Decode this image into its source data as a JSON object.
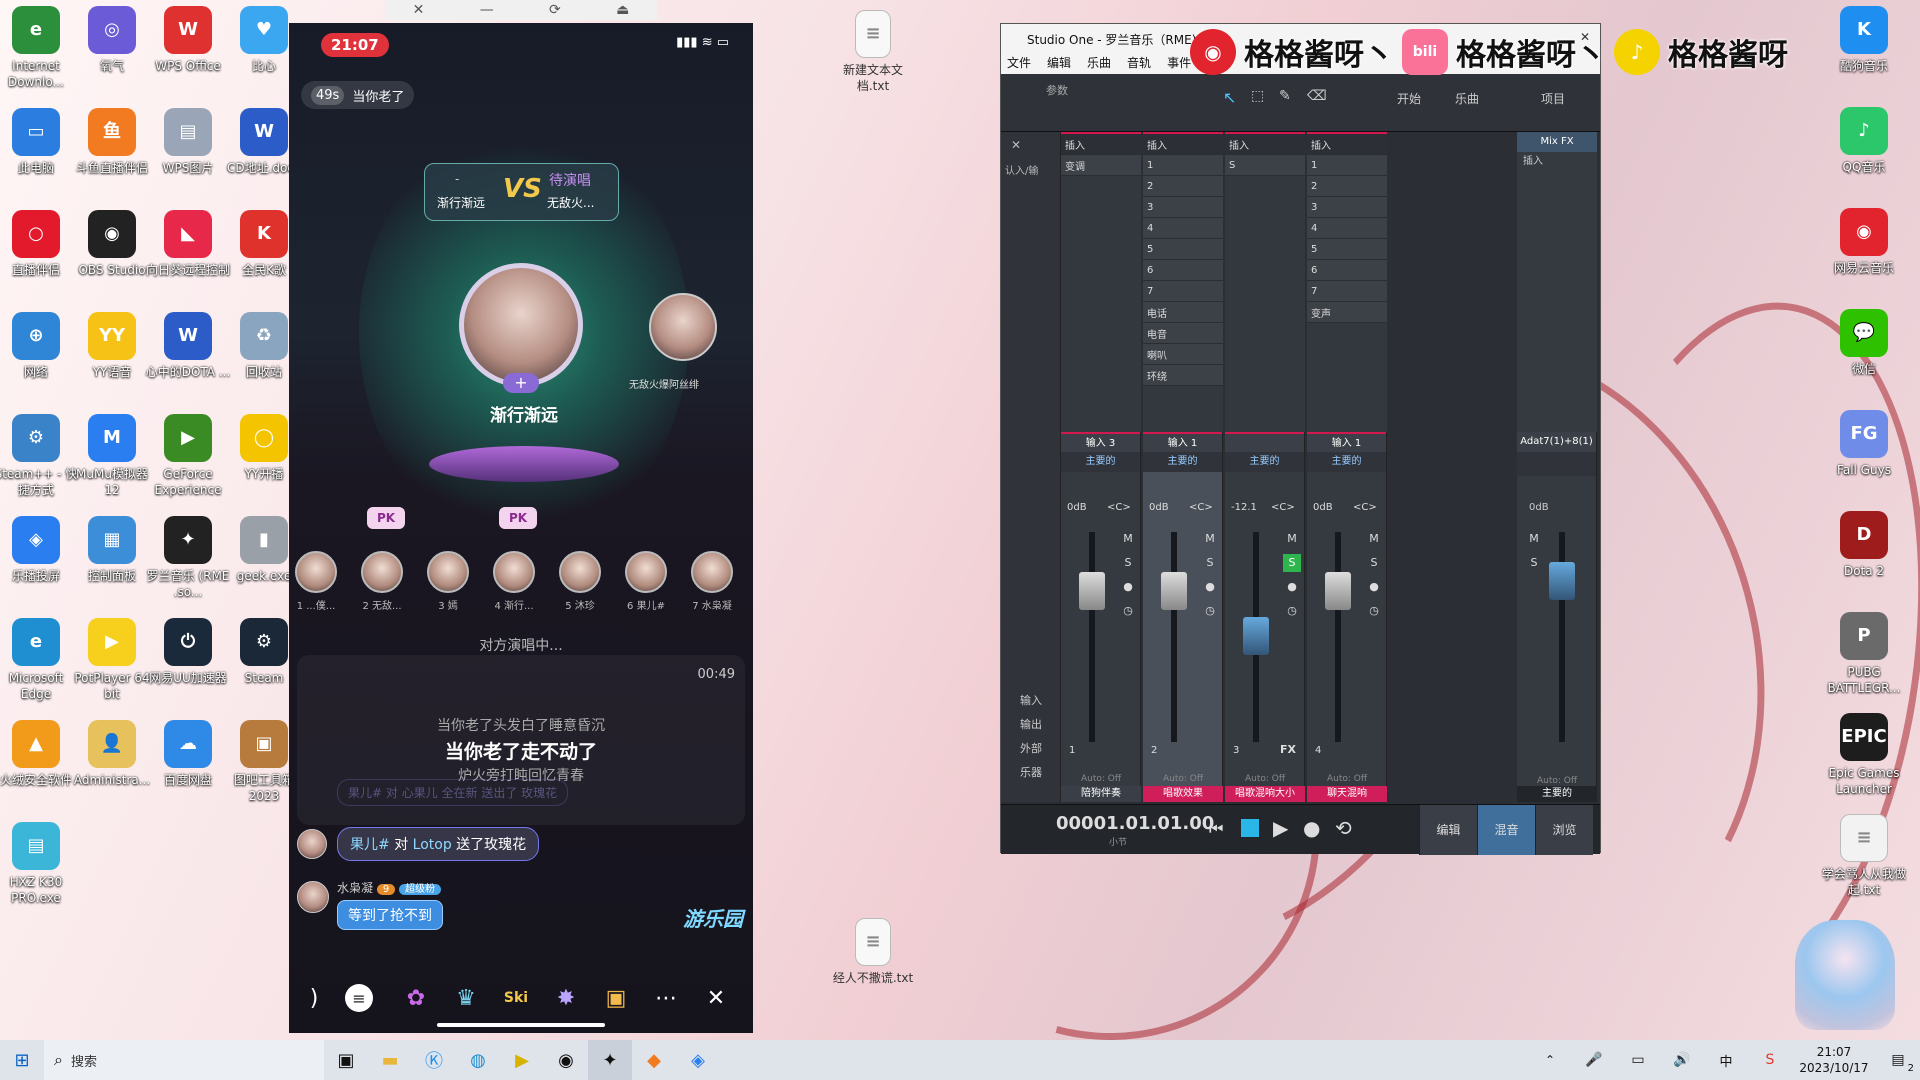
{
  "desktop": {
    "left_icons": [
      {
        "label": "Internet Downlo...",
        "icon": "idm-icon",
        "color": "#2c8f3b",
        "glyph": "e"
      },
      {
        "label": "氧气",
        "icon": "oxygen-icon",
        "color": "#6b5bd6",
        "glyph": "◎"
      },
      {
        "label": "WPS Office",
        "icon": "wps-office-icon",
        "color": "#e03131",
        "glyph": "W"
      },
      {
        "label": "比心",
        "icon": "bixin-icon",
        "color": "#3aa7f0",
        "glyph": "♥"
      },
      {
        "label": "此电脑",
        "icon": "this-pc-icon",
        "color": "#2b7de0",
        "glyph": "▭"
      },
      {
        "label": "斗鱼直播伴侣",
        "icon": "douyu-icon",
        "color": "#f27a21",
        "glyph": "鱼"
      },
      {
        "label": "WPS图片",
        "icon": "wps-image-icon",
        "color": "#9aa5b8",
        "glyph": "▤"
      },
      {
        "label": "CD地址.docx",
        "icon": "word-doc-icon",
        "color": "#2b5cc8",
        "glyph": "W"
      },
      {
        "label": "直播伴侣",
        "icon": "live-companion-icon",
        "color": "#e3192c",
        "glyph": "○"
      },
      {
        "label": "OBS Studio",
        "icon": "obs-icon",
        "color": "#222",
        "glyph": "◉"
      },
      {
        "label": "向日葵远程控制",
        "icon": "sunflower-icon",
        "color": "#e8284a",
        "glyph": "◣"
      },
      {
        "label": "全民K歌",
        "icon": "quanmin-k-icon",
        "color": "#e0322d",
        "glyph": "K"
      },
      {
        "label": "网络",
        "icon": "network-icon",
        "color": "#2f86d6",
        "glyph": "⊕"
      },
      {
        "label": "YY语音",
        "icon": "yy-icon",
        "color": "#f6c216",
        "glyph": "YY"
      },
      {
        "label": "心中的DOTA ...",
        "icon": "word-doc-icon",
        "color": "#2b5cc8",
        "glyph": "W"
      },
      {
        "label": "回收站",
        "icon": "recycle-bin-icon",
        "color": "#8aa5c0",
        "glyph": "♻"
      },
      {
        "label": "Steam++ - 快捷方式",
        "icon": "steampp-icon",
        "color": "#3b83c9",
        "glyph": "⚙"
      },
      {
        "label": "MuMu模拟器12",
        "icon": "mumu-icon",
        "color": "#2a7ef0",
        "glyph": "M"
      },
      {
        "label": "GeForce Experience",
        "icon": "geforce-icon",
        "color": "#3b8b25",
        "glyph": "▶"
      },
      {
        "label": "YY开播",
        "icon": "yy-live-icon",
        "color": "#f5c400",
        "glyph": "◯"
      },
      {
        "label": "乐播投屏",
        "icon": "lebo-icon",
        "color": "#2a7ef0",
        "glyph": "◈"
      },
      {
        "label": "控制面板",
        "icon": "control-panel-icon",
        "color": "#3c8ed8",
        "glyph": "▦"
      },
      {
        "label": "罗兰音乐 (RME .so...",
        "icon": "studio-one-icon",
        "color": "#222",
        "glyph": "✦"
      },
      {
        "label": "geek.exe",
        "icon": "geek-icon",
        "color": "#9aa0a8",
        "glyph": "▮"
      },
      {
        "label": "Microsoft Edge",
        "icon": "edge-icon",
        "color": "#1f8fd1",
        "glyph": "e"
      },
      {
        "label": "PotPlayer 64 bit",
        "icon": "potplayer-icon",
        "color": "#f7cf1d",
        "glyph": "▶"
      },
      {
        "label": "网易UU加速器",
        "icon": "uu-icon",
        "color": "#1b2a3a",
        "glyph": "⏻"
      },
      {
        "label": "Steam",
        "icon": "steam-icon",
        "color": "#1b2838",
        "glyph": "⚙"
      },
      {
        "label": "火绒安全软件",
        "icon": "huorong-icon",
        "color": "#f29a1a",
        "glyph": "▲"
      },
      {
        "label": "Administra...",
        "icon": "user-folder-icon",
        "color": "#e7c25c",
        "glyph": "👤"
      },
      {
        "label": "百度网盘",
        "icon": "baidu-netdisk-icon",
        "color": "#2e8ae6",
        "glyph": "☁"
      },
      {
        "label": "图吧工具箱2023",
        "icon": "tuba-icon",
        "color": "#b67b3d",
        "glyph": "▣"
      },
      {
        "label": "HXZ K30 PRO.exe",
        "icon": "exe-icon",
        "color": "#3bb5d8",
        "glyph": "▤"
      }
    ],
    "middle_icons": [
      {
        "label": "新建文本文档.txt",
        "icon": "text-file-icon"
      },
      {
        "label": "经人不撒谎.txt",
        "icon": "text-file-icon"
      }
    ],
    "right_icons": [
      {
        "label": "酷狗音乐",
        "icon": "kugou-icon",
        "color": "#1e8ff0",
        "glyph": "K"
      },
      {
        "label": "QQ音乐",
        "icon": "qq-music-icon",
        "color": "#2cc66b",
        "glyph": "♪"
      },
      {
        "label": "网易云音乐",
        "icon": "netease-music-icon",
        "color": "#e1242e",
        "glyph": "◉"
      },
      {
        "label": "微信",
        "icon": "wechat-icon",
        "color": "#2dc100",
        "glyph": "💬"
      },
      {
        "label": "Fall Guys",
        "icon": "fall-guys-icon",
        "color": "#6f8de8",
        "glyph": "FG"
      },
      {
        "label": "Dota 2",
        "icon": "dota2-icon",
        "color": "#9e1c1c",
        "glyph": "D"
      },
      {
        "label": "PUBG BATTLEGR...",
        "icon": "pubg-icon",
        "color": "#6a6a6a",
        "glyph": "P"
      },
      {
        "label": "Epic Games Launcher",
        "icon": "epic-icon",
        "color": "#1d1d1d",
        "glyph": "EPIC"
      },
      {
        "label": "学会骂人从我做起.txt",
        "icon": "text-file-icon",
        "color": "#f2f2f2",
        "glyph": "≡"
      }
    ]
  },
  "phone": {
    "time": "21:07",
    "topic_pill": {
      "prefix": "49s",
      "text": "当你老了"
    },
    "pk": {
      "vs": "VS",
      "left_dash": "-",
      "left_name": "渐行渐远",
      "right_status": "待演唱",
      "right_name": "无敌火..."
    },
    "singer_name": "渐行渐远",
    "side_name": "无敌火爆阿丝绯",
    "seats": [
      "1 ...僕...",
      "2 无敌...",
      "3 嫣",
      "4 渐行...",
      "5 沐珍",
      "6 果儿#",
      "7 水枭凝"
    ],
    "pk_badge": "PK",
    "status": "对方演唱中...",
    "lyric_time": "00:49",
    "lyrics": [
      "当你老了头发白了睡意昏沉",
      "当你老了走不动了",
      "炉火旁打盹回忆青春"
    ],
    "chat": {
      "gift_user": "果儿#",
      "gift_text": "对",
      "gift_target": "Lotop",
      "gift_suffix": "送了玫瑰花",
      "faded_gift": "果儿# 对 心果儿 全在新 送出了 玫瑰花",
      "msg_user": "水枭凝",
      "msg_level": "9",
      "msg_badge": "超级粉",
      "msg_text": "等到了抢不到"
    },
    "park_label": "游乐园"
  },
  "studio": {
    "title": "Studio One - 罗兰音乐（RME)",
    "menu": [
      "文件",
      "编辑",
      "乐曲",
      "音轨",
      "事件"
    ],
    "toolbar": {
      "params": "参数",
      "start": "开始",
      "song": "乐曲",
      "project": "项目"
    },
    "insert_label": "插入",
    "input_label": "认入/输",
    "mixfx": "Mix FX",
    "strip_slots": [
      [
        "变调"
      ],
      [
        "1",
        "2",
        "3",
        "4",
        "5",
        "6",
        "7",
        "电话",
        "电音",
        "喇叭",
        "环绕"
      ],
      [
        "S"
      ],
      [
        "1",
        "2",
        "3",
        "4",
        "5",
        "6",
        "7",
        "变声"
      ]
    ],
    "channels": [
      {
        "input": "输入 3",
        "bus": "主要的",
        "vol": "0dB",
        "pan": "<C>",
        "num": "1",
        "label": "陪狗伴奏",
        "label_color": "#3a3f47"
      },
      {
        "input": "输入 1",
        "bus": "主要的",
        "vol": "0dB",
        "pan": "<C>",
        "num": "2",
        "label": "唱歌效果",
        "label_color": "#d01e5a"
      },
      {
        "input": "",
        "bus": "主要的",
        "vol": "-12.1",
        "pan": "<C>",
        "num": "3",
        "label": "唱歌混响大小",
        "label_color": "#d01e5a"
      },
      {
        "input": "输入 1",
        "bus": "主要的",
        "vol": "0dB",
        "pan": "<C>",
        "num": "4",
        "label": "聊天混响",
        "label_color": "#d01e5a"
      }
    ],
    "master": {
      "name": "Adat7(1)+8(1)",
      "vol": "0dB",
      "label": "主要的"
    },
    "side_labels": [
      "输入",
      "输出",
      "外部",
      "乐器"
    ],
    "auto": "Auto: Off",
    "buttons": {
      "mute": "M",
      "solo": "S",
      "fx": "FX"
    },
    "transport": {
      "time": "00001.01.01.00",
      "unit": "小节"
    },
    "views": [
      "编辑",
      "混音",
      "浏览"
    ]
  },
  "overlay": {
    "name": "格格酱呀丶",
    "name2": "格格酱呀丶",
    "name3": "格格酱呀",
    "icons": [
      "netease-music-icon",
      "bilibili-icon",
      "qq-music-icon"
    ]
  },
  "taskbar": {
    "search": "搜索",
    "ime": "中",
    "time": "21:07",
    "date": "2023/10/17",
    "notification_count": "2"
  }
}
